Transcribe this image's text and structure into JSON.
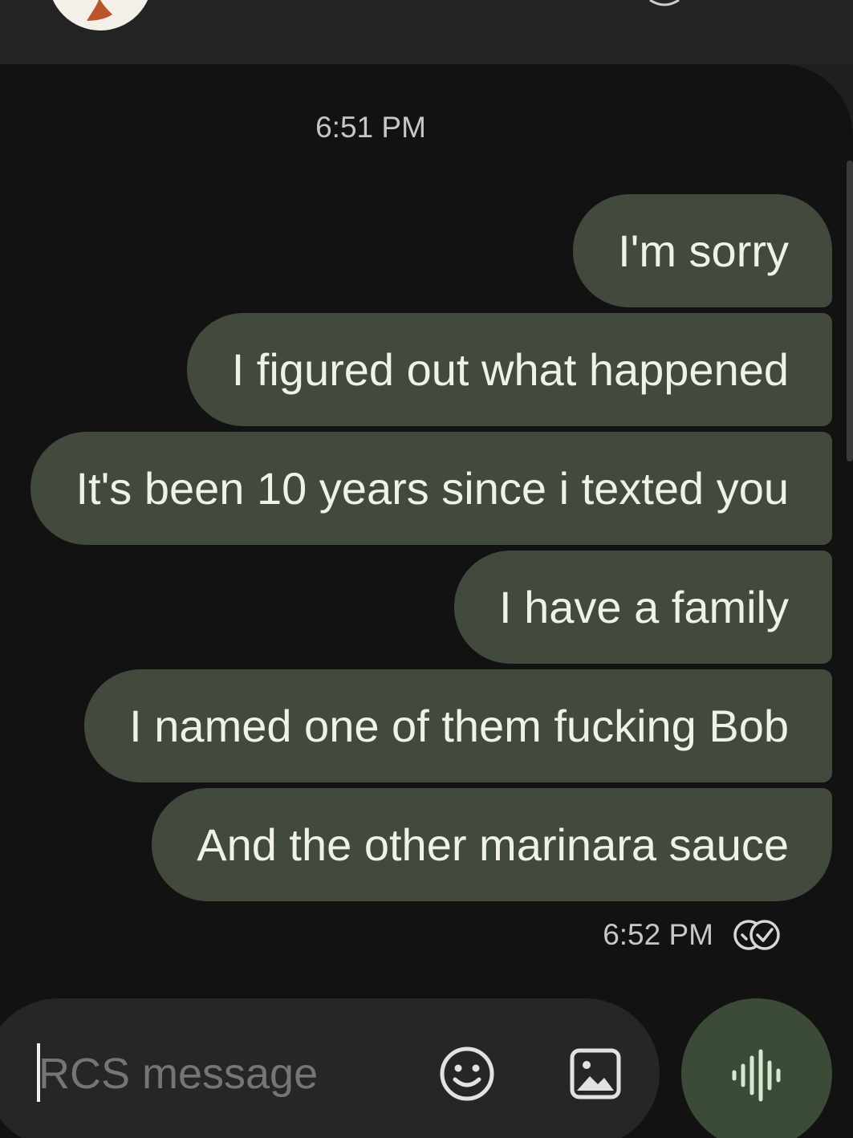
{
  "conversation": {
    "date_separator": "6:51 PM",
    "messages": [
      {
        "text": "I'm sorry"
      },
      {
        "text": "I figured out what happened"
      },
      {
        "text": "It's been 10 years since i texted you"
      },
      {
        "text": "I have a family"
      },
      {
        "text": "I named one of them fucking Bob"
      },
      {
        "text": "And the other marinara sauce"
      }
    ],
    "last_sent_time": "6:52 PM",
    "delivery_status_icon": "read-double-check-icon"
  },
  "compose": {
    "placeholder": "RCS message",
    "emoji_icon": "emoji-icon",
    "gallery_icon": "image-icon",
    "voice_icon": "voice-message-icon"
  },
  "colors": {
    "bubble": "#424a3d",
    "bubble_text": "#f1f1ec",
    "background": "#121212",
    "voice_button": "#3c4a38"
  }
}
